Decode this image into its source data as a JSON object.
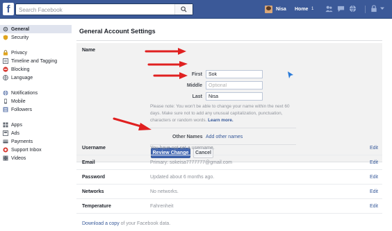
{
  "topbar": {
    "logo": "f",
    "search_placeholder": "Search Facebook",
    "user_name": "Nisa",
    "home_label": "Home",
    "home_badge": "1",
    "icons": [
      "friends-icon",
      "messages-icon",
      "globe-icon",
      "lock-icon",
      "caret-down-icon"
    ],
    "brand_color": "#3b5998"
  },
  "sidebar": {
    "groups": [
      {
        "items": [
          {
            "label": "General",
            "icon": "gear-icon",
            "active": true
          },
          {
            "label": "Security",
            "icon": "shield-icon",
            "active": false
          }
        ]
      },
      {
        "items": [
          {
            "label": "Privacy",
            "icon": "lock-icon",
            "active": false
          },
          {
            "label": "Timeline and Tagging",
            "icon": "timeline-icon",
            "active": false
          },
          {
            "label": "Blocking",
            "icon": "blocking-icon",
            "active": false
          },
          {
            "label": "Language",
            "icon": "language-icon",
            "active": false
          }
        ]
      },
      {
        "items": [
          {
            "label": "Notifications",
            "icon": "globe-icon",
            "active": false
          },
          {
            "label": "Mobile",
            "icon": "mobile-icon",
            "active": false
          },
          {
            "label": "Followers",
            "icon": "followers-icon",
            "active": false
          }
        ]
      },
      {
        "items": [
          {
            "label": "Apps",
            "icon": "apps-icon",
            "active": false
          },
          {
            "label": "Ads",
            "icon": "ads-icon",
            "active": false
          },
          {
            "label": "Payments",
            "icon": "payments-icon",
            "active": false
          },
          {
            "label": "Support Inbox",
            "icon": "support-icon",
            "active": false
          },
          {
            "label": "Videos",
            "icon": "videos-icon",
            "active": false
          }
        ]
      }
    ]
  },
  "main": {
    "title": "General Account Settings",
    "name_section": {
      "label": "Name",
      "first_label": "First",
      "first_value": "Sok",
      "middle_label": "Middle",
      "middle_placeholder": "Optional",
      "last_label": "Last",
      "last_value": "Nisa",
      "note": "Please note: You won't be able to change your name within the next 60 days. Make sure not to add any unusual capitalization, punctuation, characters or random words.",
      "note_link": "Learn more.",
      "other_names_label": "Other Names",
      "other_names_link": "Add other names",
      "review_button": "Review Change",
      "cancel_button": "Cancel"
    },
    "rows": [
      {
        "label": "Username",
        "value": "You have not set a username.",
        "edit": "Edit"
      },
      {
        "label": "Email",
        "value": "Primary: sokeisa7777777@gmail.com",
        "edit": "Edit"
      },
      {
        "label": "Password",
        "value": "Updated about 6 months ago.",
        "edit": "Edit"
      },
      {
        "label": "Networks",
        "value": "No networks.",
        "edit": "Edit"
      },
      {
        "label": "Temperature",
        "value": "Fahrenheit",
        "edit": "Edit"
      }
    ],
    "download_link": "Download a copy",
    "download_suffix": " of your Facebook data."
  },
  "annotation_color": "#e02020"
}
